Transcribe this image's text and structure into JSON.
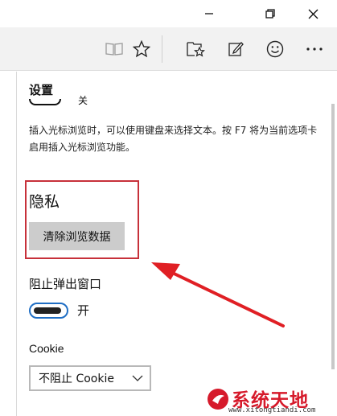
{
  "settings": {
    "title": "设置",
    "partial_toggle_state": "关",
    "caret_browsing_desc": "插入光标浏览时，可以使用键盘来选择文本。按 F7 将为当前选项卡启用插入光标浏览功能。",
    "privacy_heading": "隐私",
    "clear_data_button": "清除浏览数据",
    "block_popups_label": "阻止弹出窗口",
    "block_popups_state": "开",
    "cookie_label": "Cookie",
    "cookie_selected": "不阻止 Cookie"
  },
  "icons": {
    "minimize": "minimize-icon",
    "maximize": "restore-icon",
    "close": "close-icon",
    "reading_view": "book-icon",
    "favorite": "star-icon",
    "hub": "favorites-hub-icon",
    "web_note": "pen-note-icon",
    "feedback": "smiley-icon",
    "more": "more-icon"
  },
  "colors": {
    "highlight": "#c7313a",
    "arrow": "#e01f24",
    "toggle_border": "#1f6ec4",
    "watermark": "#d61a2b"
  },
  "watermark": {
    "brand": "系统天地",
    "url": "www.xitongtiandi.com"
  }
}
